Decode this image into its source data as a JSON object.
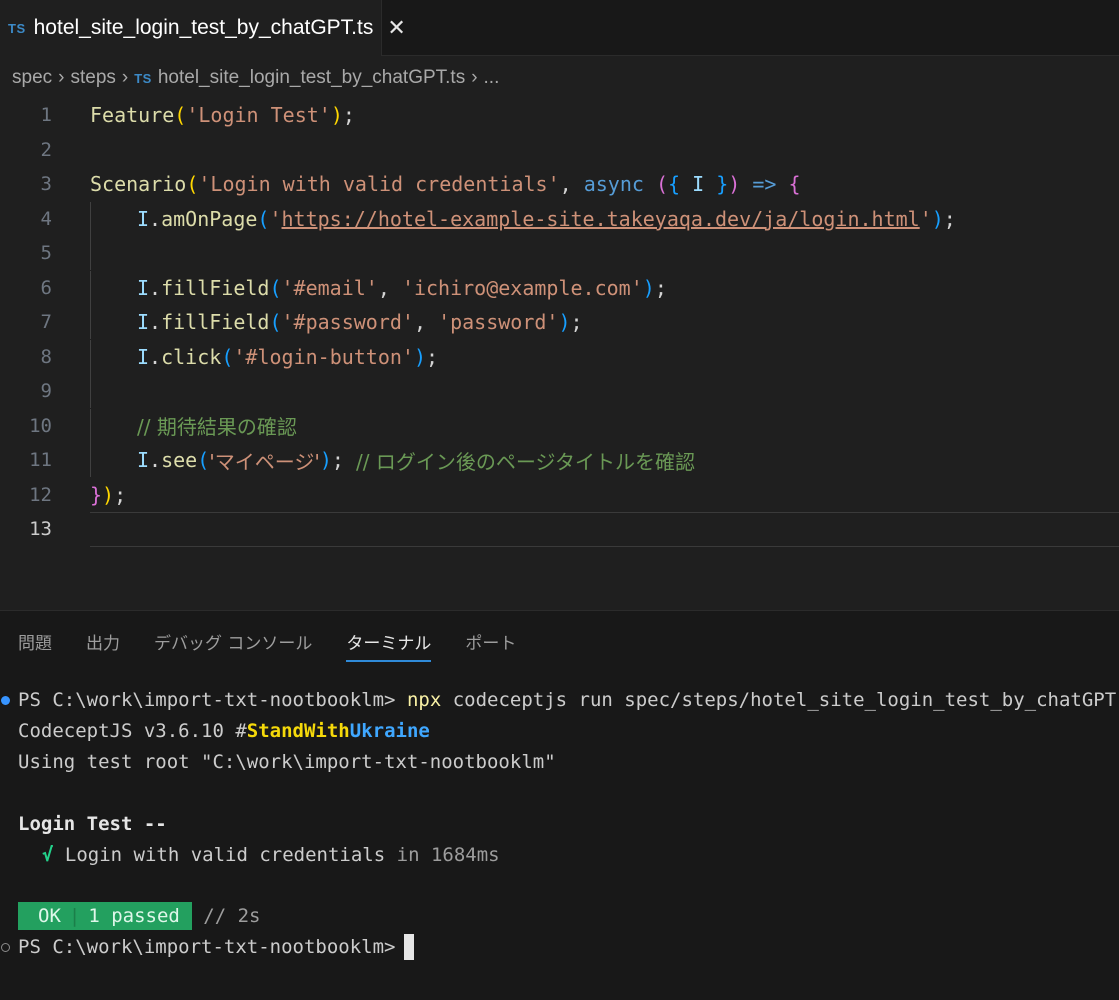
{
  "tab": {
    "icon_text": "TS",
    "title": "hotel_site_login_test_by_chatGPT.ts",
    "close_glyph": "✕"
  },
  "breadcrumb": {
    "seg1": "spec",
    "seg2": "steps",
    "icon_text": "TS",
    "file": "hotel_site_login_test_by_chatGPT.ts",
    "more": "..."
  },
  "editor": {
    "line_numbers": [
      "1",
      "2",
      "3",
      "4",
      "5",
      "6",
      "7",
      "8",
      "9",
      "10",
      "11",
      "12",
      "13"
    ],
    "active_line": 13,
    "l1": {
      "fn": "Feature",
      "open": "(",
      "str": "'Login Test'",
      "close": ")",
      "end": ";"
    },
    "l3": {
      "fn": "Scenario",
      "open": "(",
      "str": "'Login with valid credentials'",
      "comma": ", ",
      "kw": "async",
      "sp": " ",
      "p2o": "(",
      "b3o": "{",
      "var": " I ",
      "b3c": "}",
      "p2c": ")",
      "arrow": " => ",
      "brace": "{"
    },
    "l4": {
      "obj": "I",
      "dot": ".",
      "fn": "amOnPage",
      "open": "(",
      "q1": "'",
      "url": "https://hotel-example-site.takeyaqa.dev/ja/login.html",
      "q2": "'",
      "close": ")",
      "end": ";"
    },
    "l6": {
      "obj": "I",
      "dot": ".",
      "fn": "fillField",
      "open": "(",
      "s1": "'#email'",
      "comma": ", ",
      "s2": "'ichiro@example.com'",
      "close": ")",
      "end": ";"
    },
    "l7": {
      "obj": "I",
      "dot": ".",
      "fn": "fillField",
      "open": "(",
      "s1": "'#password'",
      "comma": ", ",
      "s2": "'password'",
      "close": ")",
      "end": ";"
    },
    "l8": {
      "obj": "I",
      "dot": ".",
      "fn": "click",
      "open": "(",
      "s1": "'#login-button'",
      "close": ")",
      "end": ";"
    },
    "l10": {
      "cmt": "// 期待結果の確認"
    },
    "l11": {
      "obj": "I",
      "dot": ".",
      "fn": "see",
      "open": "(",
      "s1": "'マイページ'",
      "close": ")",
      "end": "; ",
      "cmt": "// ログイン後のページタイトルを確認"
    },
    "l12": {
      "brace": "}",
      "close": ")",
      "end": ";"
    }
  },
  "panel": {
    "tabs": [
      "問題",
      "出力",
      "デバッグ コンソール",
      "ターミナル",
      "ポート"
    ],
    "active_tab": "ターミナル"
  },
  "terminal": {
    "prompt": "PS C:\\work\\import-txt-nootbooklm> ",
    "cmd_npx": "npx",
    "cmd_rest": " codeceptjs run spec/steps/hotel_site_login_test_by_chatGPT.ts",
    "version": "CodeceptJS v3.6.10 #",
    "stand": "Stand",
    "with": "With",
    "ukraine": "Ukraine",
    "root": "Using test root \"C:\\work\\import-txt-nootbooklm\"",
    "feature": "Login Test --",
    "check": "√",
    "scenario": " Login with valid credentials",
    "duration": " in 1684ms",
    "ok": "OK",
    "pipe": "|",
    "passed": "1 passed",
    "elapsed": " // 2s",
    "prompt2": "PS C:\\work\\import-txt-nootbooklm>"
  },
  "colors": {
    "background": "#1f1f1f",
    "accent": "#2f8ad8",
    "pass_badge": "#23a05f"
  }
}
